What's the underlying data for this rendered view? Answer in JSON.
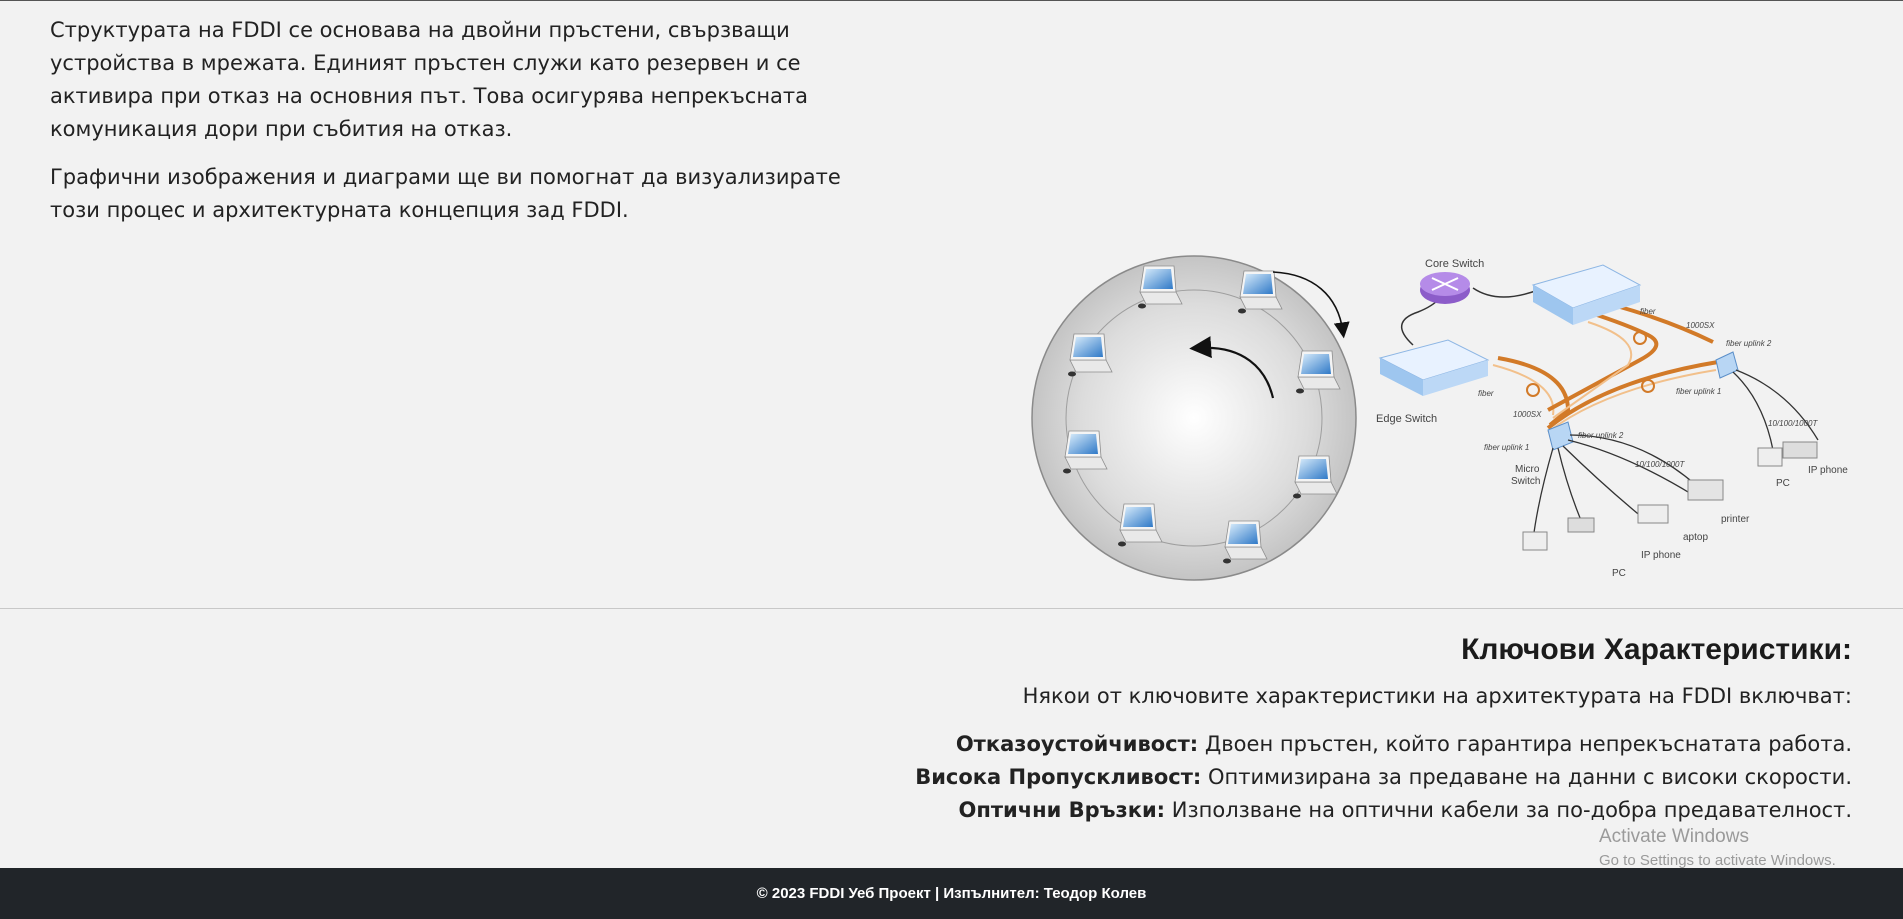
{
  "intro": {
    "paragraph_1": "Структурата на FDDI се основава на двойни пръстени, свързващи устройства в мрежата. Единият пръстен служи като резервен и се активира при отказ на основния път. Това осигурява непрекъсната комуникация дори при събития на отказ.",
    "paragraph_2": "Графични изображения и диаграми ще ви помогнат да визуализирате този процес и архитектурната концепция зад FDDI."
  },
  "diagram": {
    "ring_icon": "token-ring-laptops-diagram",
    "network_icon": "fiber-network-topology-diagram",
    "labels": {
      "core_switch": "Core Switch",
      "edge_switch": "Edge Switch",
      "micro_switch_1": "Micro",
      "micro_switch_2": "Switch",
      "fiber_a": "fiber",
      "fiber_b": "fiber",
      "sx_a": "1000SX",
      "sx_b": "1000SX",
      "uplink_2_top": "fiber uplink 2",
      "uplink_1_top": "fiber uplink 1",
      "uplink_1_bottom": "fiber uplink 1",
      "uplink_2_bottom": "fiber uplink 2",
      "speed_a": "10/100/1000T",
      "speed_b": "10/100/1000T",
      "ip_phone_a": "IP phone",
      "pc_a": "PC",
      "printer": "printer",
      "laptop": "aptop",
      "ip_phone_b": "IP phone",
      "pc_b": "PC"
    }
  },
  "features": {
    "heading": "Ключови Характеристики:",
    "lead": "Някои от ключовите характеристики на архитектурата на FDDI включват:",
    "items": [
      {
        "term": "Отказоустойчивост:",
        "desc": " Двоен пръстен, който гарантира непрекъснатата работа."
      },
      {
        "term": "Висока Пропускливост:",
        "desc": " Оптимизирана за предаване на данни с високи скорости."
      },
      {
        "term": "Оптични Връзки:",
        "desc": " Използване на оптични кабели за по-добра предавателност."
      }
    ]
  },
  "watermark": {
    "title": "Activate Windows",
    "subtitle": "Go to Settings to activate Windows."
  },
  "footer": {
    "text": "© 2023 FDDI Уеб Проект | Изпълнител: Теодор Колев"
  }
}
